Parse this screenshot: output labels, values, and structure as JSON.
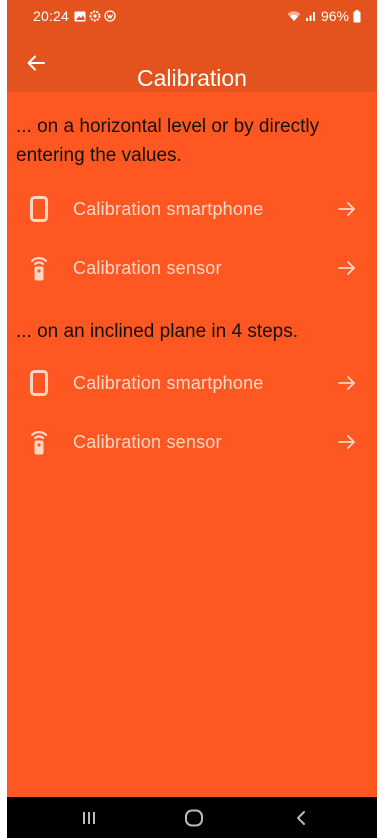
{
  "status_bar": {
    "time": "20:24",
    "battery": "96%",
    "left_icons": [
      "gallery-icon",
      "settings-icon",
      "vpn-icon"
    ],
    "right_icons": [
      "wifi-icon",
      "signal-icon",
      "battery-icon"
    ]
  },
  "app_bar": {
    "title": "Calibration",
    "back_icon": "arrow-left-icon"
  },
  "sections": [
    {
      "heading": "... on a horizontal level or by directly entering the values.",
      "items": [
        {
          "label": "Calibration smartphone",
          "icon": "smartphone-icon"
        },
        {
          "label": "Calibration sensor",
          "icon": "sensor-icon"
        }
      ]
    },
    {
      "heading": "... on an inclined plane in 4 steps.",
      "items": [
        {
          "label": "Calibration smartphone",
          "icon": "smartphone-icon"
        },
        {
          "label": "Calibration sensor",
          "icon": "sensor-icon"
        }
      ]
    }
  ],
  "nav_bar": {
    "buttons": [
      "recent-apps-icon",
      "home-icon",
      "back-icon"
    ]
  },
  "colors": {
    "app_bar": "#E4531E",
    "background": "#FE5722",
    "item_text": "#FDD7C6",
    "heading_text": "#111111",
    "nav_bar": "#000000"
  }
}
